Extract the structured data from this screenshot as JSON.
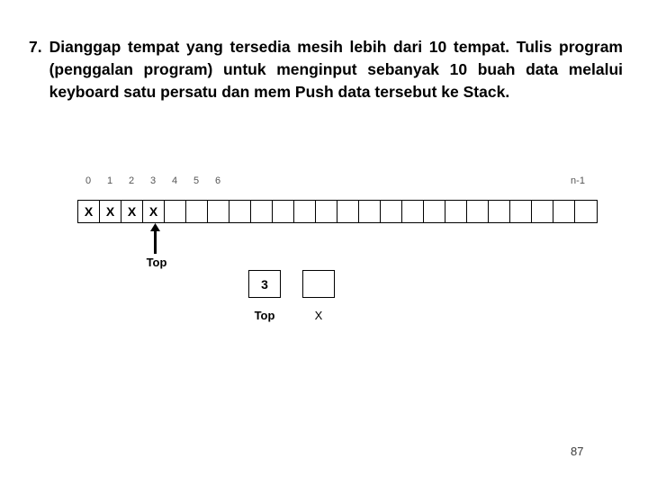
{
  "question": {
    "number": "7.",
    "text": "Dianggap tempat yang tersedia mesih lebih dari 10 tempat. Tulis program (penggalan program) untuk menginput sebanyak 10 buah data melalui keyboard satu persatu dan mem Push data tersebut ke Stack."
  },
  "diagram": {
    "index_labels": [
      "0",
      "1",
      "2",
      "3",
      "4",
      "5",
      "6"
    ],
    "last_index_label": "n-1",
    "cell_count": 24,
    "cells": [
      "X",
      "X",
      "X",
      "X",
      "",
      "",
      "",
      "",
      "",
      "",
      "",
      "",
      "",
      "",
      "",
      "",
      "",
      "",
      "",
      "",
      "",
      "",
      "",
      ""
    ],
    "pointer": {
      "label": "Top",
      "points_to_index": 3,
      "icon": "arrow-up-icon"
    },
    "variables": [
      {
        "name": "top-variable",
        "value": "3",
        "label": "Top"
      },
      {
        "name": "x-variable",
        "value": "",
        "label": "X"
      }
    ]
  },
  "footer": {
    "page_number": "87"
  },
  "colors": {
    "ink": "#000000",
    "index_label": "#555555",
    "page_number": "#3a3a3a",
    "background": "#ffffff"
  }
}
